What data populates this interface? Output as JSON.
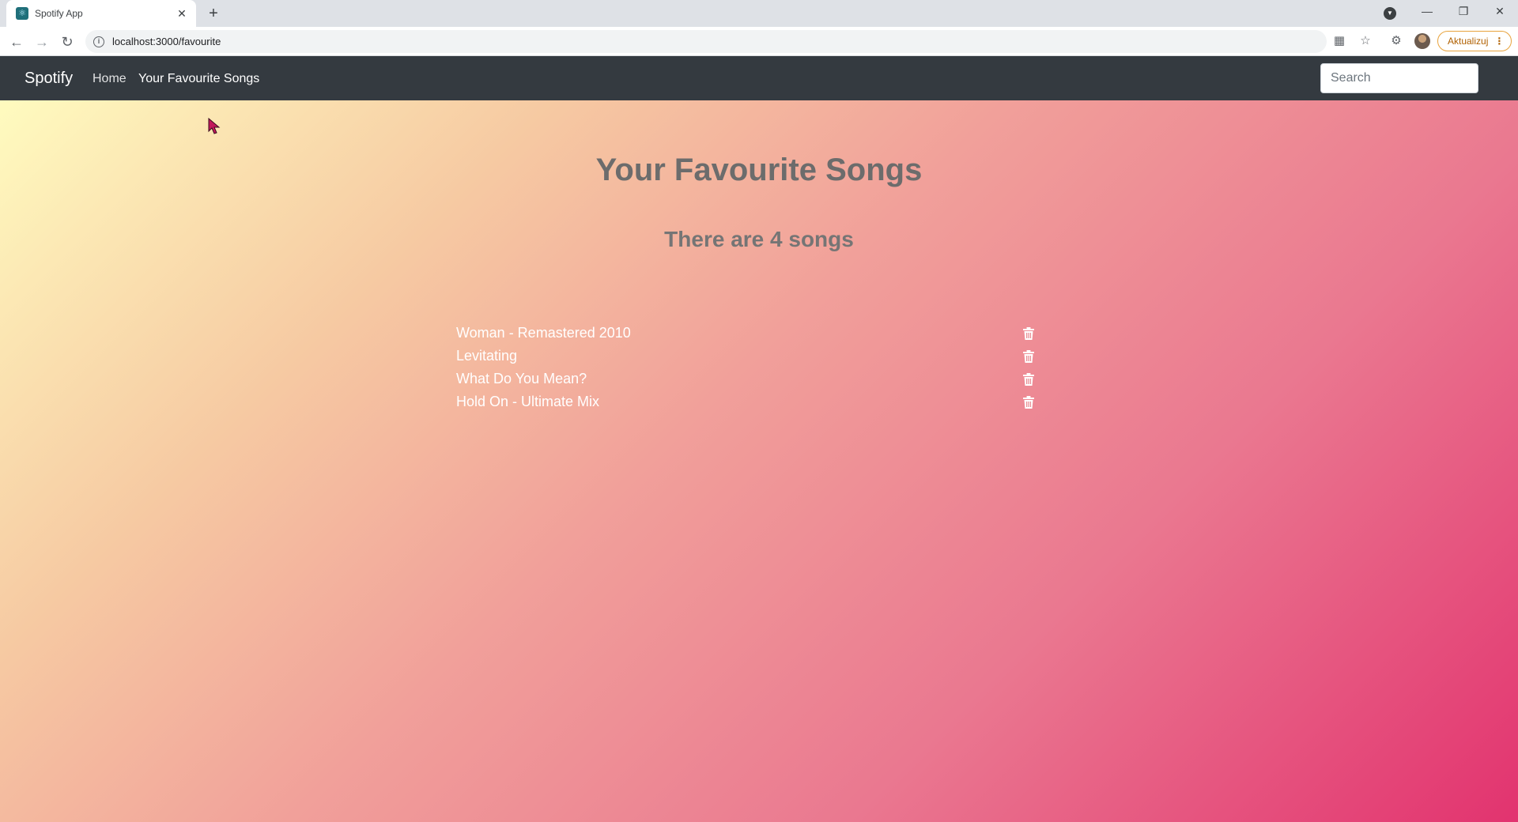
{
  "browser": {
    "tab_title": "Spotify App",
    "tab_close": "✕",
    "new_tab": "+",
    "url": "localhost:3000/favourite",
    "update_button": "Aktualizuj",
    "update_menu": "⋮",
    "icons": [
      "back-icon",
      "forward-icon",
      "reload-icon",
      "info-icon",
      "translate-icon",
      "star-icon",
      "extensions-icon",
      "profile-avatar"
    ]
  },
  "navbar": {
    "brand": "Spotify",
    "links": [
      {
        "label": "Home"
      },
      {
        "label": "Your Favourite Songs"
      }
    ],
    "search_placeholder": "Search"
  },
  "main": {
    "title": "Your Favourite Songs",
    "count_text": "There are 4 songs",
    "songs": [
      {
        "name": "Woman - Remastered 2010"
      },
      {
        "name": "Levitating"
      },
      {
        "name": "What Do You Mean?"
      },
      {
        "name": "Hold On - Ultimate Mix"
      }
    ]
  },
  "colors": {
    "navbar_bg": "#343a40",
    "gradient_start": "#fffbbf",
    "gradient_end": "#e2336f",
    "song_text": "#ffffff",
    "title_text": "#6c6c6c"
  }
}
